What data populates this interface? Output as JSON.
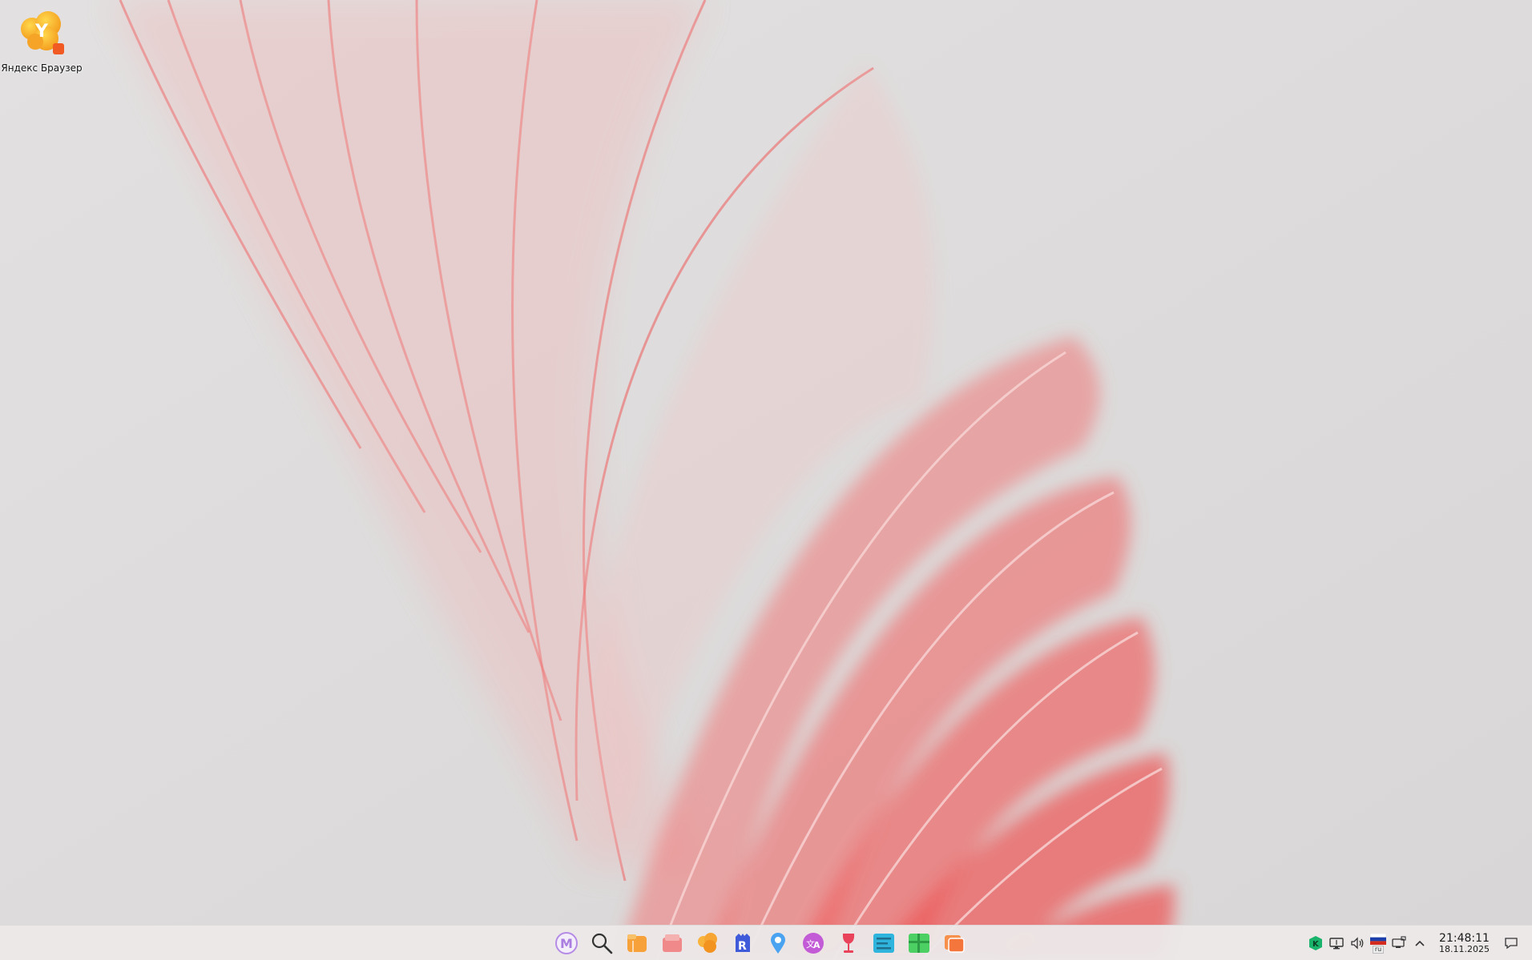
{
  "desktop": {
    "icons": [
      {
        "label": "Яндекс Браузер",
        "icon": "yandex-browser-icon"
      }
    ]
  },
  "taskbar": {
    "dock": [
      {
        "name": "m-launcher-icon",
        "color": "#b58be6"
      },
      {
        "name": "search-icon",
        "color": "#333333"
      },
      {
        "name": "files-app-icon",
        "color": "#f7a13a"
      },
      {
        "name": "folder-app-icon",
        "color": "#f08a8a"
      },
      {
        "name": "yandex-browser-icon",
        "color": "#f7a532"
      },
      {
        "name": "rustore-icon",
        "color": "#3f5bd9"
      },
      {
        "name": "maps-pin-icon",
        "color": "#4aa3f0"
      },
      {
        "name": "translate-icon",
        "color": "#c35ad6"
      },
      {
        "name": "wine-glass-icon",
        "color": "#e9435b"
      },
      {
        "name": "text-editor-icon",
        "color": "#2fb4dd"
      },
      {
        "name": "spreadsheet-icon",
        "color": "#4ccf63"
      },
      {
        "name": "slides-app-icon",
        "color": "#f6904c"
      }
    ],
    "tray": {
      "icons": [
        "kaspersky-icon",
        "display-icon",
        "volume-icon",
        "russian-flag-icon",
        "network-icon",
        "chevron-up-icon"
      ],
      "keyboard_layout": "ru",
      "time": "21:48:11",
      "date": "18.11.2025"
    },
    "notification_icon": "notification-icon"
  },
  "colors": {
    "wallpaper_base": "#dcdcdc",
    "wallpaper_accent": "#ee5a5a"
  }
}
